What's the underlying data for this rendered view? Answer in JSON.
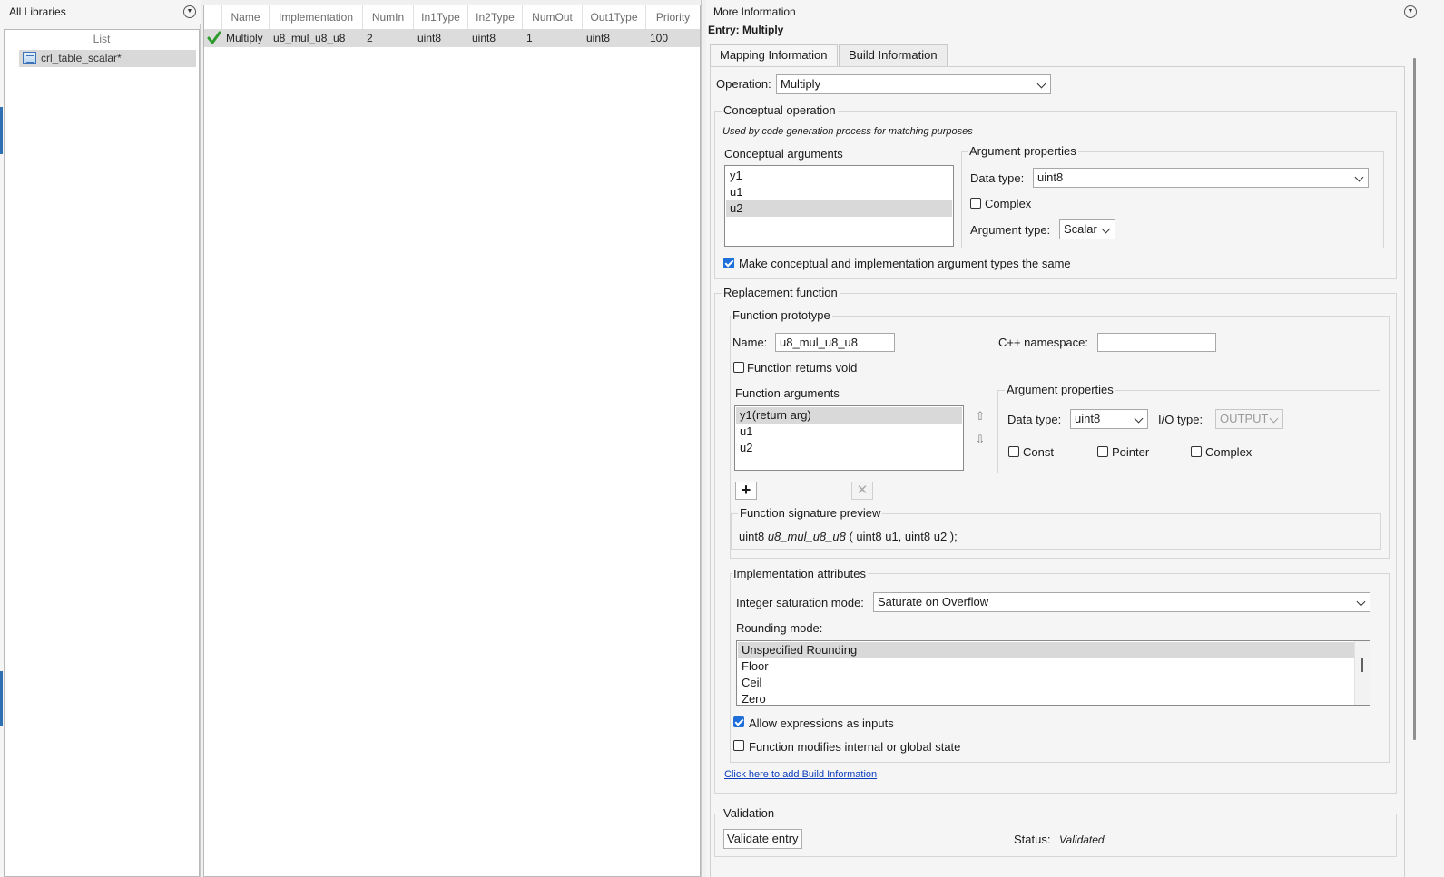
{
  "library": {
    "title": "All Libraries",
    "list_header": "List",
    "items": [
      {
        "label": "crl_table_scalar*"
      }
    ]
  },
  "table": {
    "columns": [
      "Name",
      "Implementation",
      "NumIn",
      "In1Type",
      "In2Type",
      "NumOut",
      "Out1Type",
      "Priority"
    ],
    "rows": [
      {
        "status": "check-icon",
        "Name": "Multiply",
        "Implementation": "u8_mul_u8_u8",
        "NumIn": "2",
        "In1Type": "uint8",
        "In2Type": "uint8",
        "NumOut": "1",
        "Out1Type": "uint8",
        "Priority": "100"
      }
    ]
  },
  "info": {
    "title": "More Information",
    "entry": "Entry: Multiply",
    "tabs": [
      "Mapping Information",
      "Build Information"
    ],
    "operation": {
      "label": "Operation:",
      "value": "Multiply"
    },
    "conceptual": {
      "legend": "Conceptual operation",
      "hint": "Used by code generation process for matching purposes",
      "args_label": "Conceptual arguments",
      "args": [
        "y1",
        "u1",
        "u2"
      ],
      "selected_index": 2,
      "props_legend": "Argument properties",
      "datatype_label": "Data type:",
      "datatype_value": "uint8",
      "complex_label": "Complex",
      "complex_checked": false,
      "argtype_label": "Argument type:",
      "argtype_value": "Scalar",
      "same_label": "Make conceptual and implementation argument types the same",
      "same_checked": true
    },
    "replacement": {
      "legend": "Replacement function",
      "proto_legend": "Function prototype",
      "name_label": "Name:",
      "name_value": "u8_mul_u8_u8",
      "ns_label": "C++ namespace:",
      "ns_value": "",
      "void_label": "Function returns void",
      "void_checked": false,
      "args_label": "Function arguments",
      "args": [
        "y1(return arg)",
        "u1",
        "u2"
      ],
      "selected_index": 0,
      "props_legend": "Argument properties",
      "datatype_label": "Data type:",
      "datatype_value": "uint8",
      "iotype_label": "I/O type:",
      "iotype_value": "OUTPUT",
      "const_label": "Const",
      "pointer_label": "Pointer",
      "complex_label": "Complex",
      "signature_legend": "Function signature preview",
      "sig_ret": "uint8",
      "sig_name": "u8_mul_u8_u8",
      "sig_args": "( uint8 u1, uint8 u2 );"
    },
    "impl": {
      "legend": "Implementation attributes",
      "sat_label": "Integer saturation mode:",
      "sat_value": "Saturate on Overflow",
      "rounding_label": "Rounding mode:",
      "rounding_options": [
        "Unspecified Rounding",
        "Floor",
        "Ceil",
        "Zero"
      ],
      "rounding_selected": 0,
      "allow_expr_label": "Allow expressions as inputs",
      "allow_expr_checked": true,
      "modifies_label": "Function modifies internal or global state",
      "modifies_checked": false
    },
    "build_link": "Click here to add Build Information",
    "validation": {
      "legend": "Validation",
      "button": "Validate entry",
      "status_label": "Status:",
      "status_value": "Validated"
    }
  },
  "colors": {
    "accent": "#1e6fd9",
    "selection": "#d9d9d9",
    "link": "#0b3dbd",
    "check": "#2e9b2e"
  }
}
